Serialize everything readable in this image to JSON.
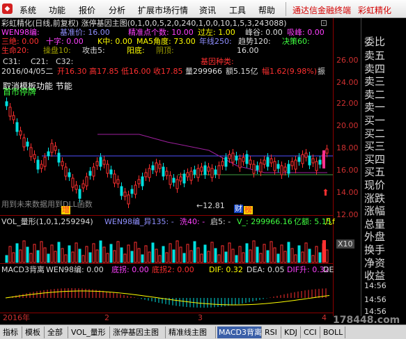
{
  "menu": {
    "items": [
      "系统",
      "功能",
      "报价",
      "分析",
      "扩展市场行情",
      "资讯",
      "工具",
      "帮助"
    ],
    "right_items": [
      "通达信金融终端",
      "彩虹精化"
    ]
  },
  "chart": {
    "title_line": "彩虹精化(日线,前复权) 涨停基因主图(0,1,0,0,5,2,0,240,1,0,0,10,1,5,3,243088)",
    "row1": {
      "a": "WEN98编:",
      "b": "基准价: 16.00",
      "c": "精准点个数: 10.00",
      "d": "过左: 1.00",
      "e": "峰谷: 0.00",
      "f": "吸峰: 0.00"
    },
    "row2": {
      "a": "三绝: 0.00",
      "b": "十字: 0.00",
      "c": "K中: 0.00",
      "d": "MA5角度: 73.00",
      "e": "年线250:",
      "f": "趋势120:",
      "g": "决策60:"
    },
    "row3": {
      "a": "生命20:",
      "b": "操盘10:",
      "c": "攻击5:",
      "d": "阳底:",
      "e": "阴顶:",
      "f": "16.00"
    },
    "row4": {
      "a": "C31:",
      "b": "C21:",
      "c": "C32:",
      "d": "基因种类:"
    },
    "ohlc": {
      "date": "2016/04/05二",
      "open": "开16.30",
      "high": "高17.85",
      "low": "低16.00",
      "close": "收17.85",
      "vol": "量299966",
      "amt": "额5.15亿",
      "pct": "幅1.62(9.98%)",
      "tail": "振"
    },
    "overlay1": "取消模板功能 节能",
    "overlay2": "首市停牌",
    "warn": "用到未来数据用到DLL函数",
    "label_low": "←12.81",
    "tag_zeng": "增",
    "tag_cai": "财",
    "tag_bang": "榜",
    "prices": [
      "26.00",
      "24.00",
      "22.00",
      "20.00",
      "18.00",
      "16.00",
      "14.00",
      "12.00"
    ]
  },
  "right_panel": {
    "stock": "委比",
    "rows": [
      "卖五",
      "卖四",
      "卖三",
      "卖二",
      "卖一",
      "买一",
      "买二",
      "买三",
      "买四",
      "买五",
      "现价",
      "涨跌",
      "涨幅",
      "总量",
      "外盘",
      "换手",
      "净资",
      "收益"
    ],
    "times": [
      "14:56",
      "14:56",
      "14:56"
    ]
  },
  "vol": {
    "header_a": "VOL_量形(1,0,1,259294)",
    "header_b": "WEN98编_异135: -",
    "header_c": "洗40: -",
    "header_d": "启5: -",
    "header_e": "V_: 299966.16",
    "header_f": "亿额: 5.15",
    "header_g": "几f",
    "scale": "X10"
  },
  "macd": {
    "header_a": "MACD3背离",
    "header_b": "WEN98编: 0.00",
    "header_c": "底拐: 0.00",
    "header_d": "底拐2: 0.00",
    "header_e": "DIF: 0.32",
    "header_f": "DEA: 0.05",
    "header_g": "DIF升: 0.32",
    "header_h": "DE"
  },
  "dates": {
    "year": "2016年",
    "m2": "2",
    "m3": "3",
    "m4": "4"
  },
  "tabs": [
    "指标",
    "模板",
    "全部",
    "VOL_量形",
    "涨停基因主图",
    "精准线主图",
    "MACD3背离",
    "RSI",
    "KDJ",
    "CCI",
    "BOLL"
  ],
  "watermark": "178448.com",
  "colors": {
    "up": "#ff3030",
    "down": "#00e0e0",
    "accent": "#3a5fa8",
    "yellow": "#ffff00",
    "magenta": "#ff40ff"
  }
}
